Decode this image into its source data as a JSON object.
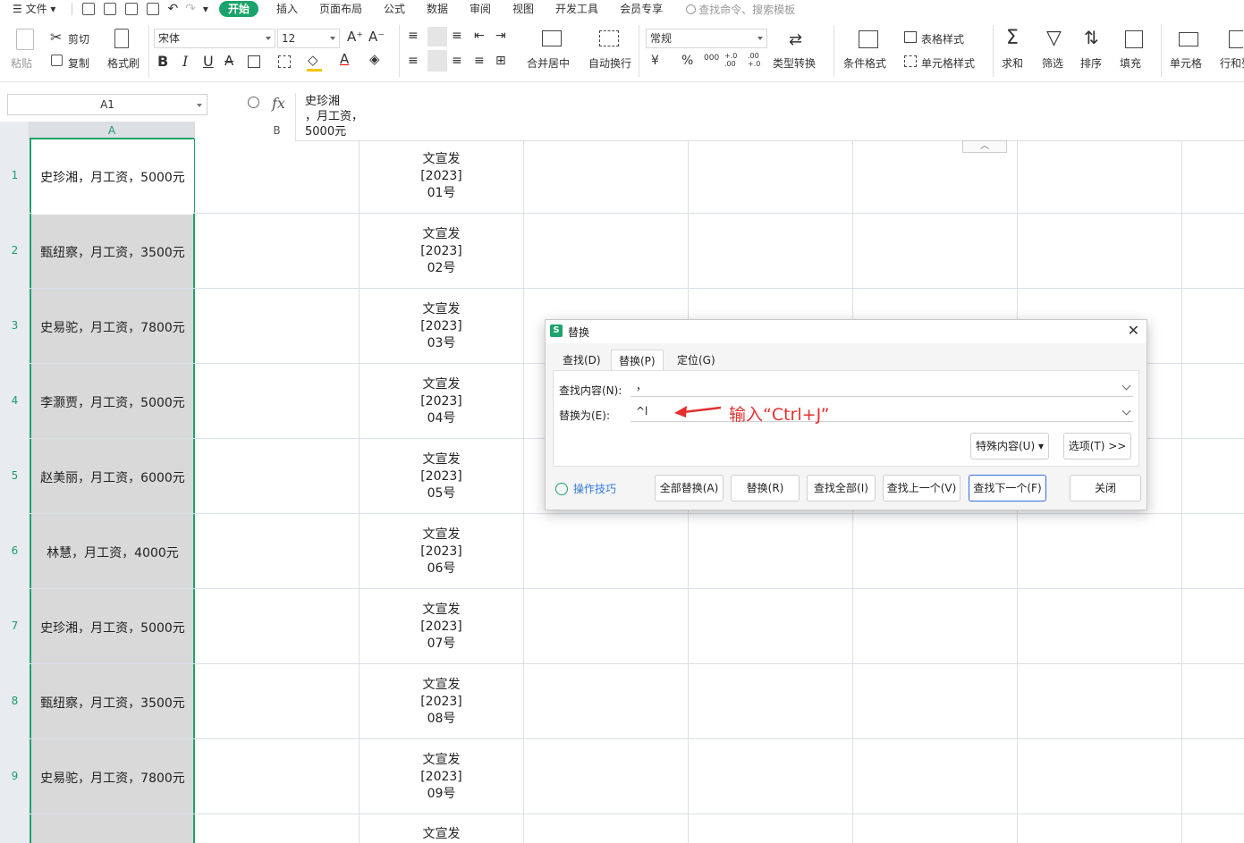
{
  "menubar": {
    "file": "文件",
    "tabs": [
      "开始",
      "插入",
      "页面布局",
      "公式",
      "数据",
      "审阅",
      "视图",
      "开发工具",
      "会员专享"
    ],
    "search_placeholder": "查找命令、搜索模板"
  },
  "ribbon": {
    "paste": "粘贴",
    "cut": "剪切",
    "copy": "复制",
    "format_painter": "格式刷",
    "font_name": "宋体",
    "font_size": "12",
    "merge_center": "合并居中",
    "wrap_text": "自动换行",
    "number_format": "常规",
    "type_convert": "类型转换",
    "conditional_format": "条件格式",
    "table_style": "表格样式",
    "cell_style": "单元格样式",
    "sum": "求和",
    "filter": "筛选",
    "sort": "排序",
    "fill": "填充",
    "cell": "单元格",
    "row_col": "行和列",
    "currency_symbol": "¥",
    "percent_symbol": "%",
    "thousands_symbol": "000",
    "inc_decimal": "+.0 .00",
    "dec_decimal": ".00 +.0"
  },
  "formula_bar": {
    "cell_ref": "A1",
    "fx": "fx",
    "content": "史珍湘\n，月工资，\n5000元"
  },
  "columns": [
    "A",
    "B"
  ],
  "rows": [
    {
      "num": "1",
      "a": "史珍湘，月工资，5000元",
      "c": [
        "文宣发",
        "[2023]",
        "01号"
      ]
    },
    {
      "num": "2",
      "a": "甄纽察，月工资，3500元",
      "c": [
        "文宣发",
        "[2023]",
        "02号"
      ]
    },
    {
      "num": "3",
      "a": "史易驼，月工资，7800元",
      "c": [
        "文宣发",
        "[2023]",
        "03号"
      ]
    },
    {
      "num": "4",
      "a": "李灏贾，月工资，5000元",
      "c": [
        "文宣发",
        "[2023]",
        "04号"
      ]
    },
    {
      "num": "5",
      "a": "赵美丽，月工资，6000元",
      "c": [
        "文宣发",
        "[2023]",
        "05号"
      ]
    },
    {
      "num": "6",
      "a": "林慧，月工资，4000元",
      "c": [
        "文宣发",
        "[2023]",
        "06号"
      ]
    },
    {
      "num": "7",
      "a": "史珍湘，月工资，5000元",
      "c": [
        "文宣发",
        "[2023]",
        "07号"
      ]
    },
    {
      "num": "8",
      "a": "甄纽察，月工资，3500元",
      "c": [
        "文宣发",
        "[2023]",
        "08号"
      ]
    },
    {
      "num": "9",
      "a": "史易驼，月工资，7800元",
      "c": [
        "文宣发",
        "[2023]",
        "09号"
      ]
    },
    {
      "num": "",
      "a": "",
      "c": [
        "文宣发",
        "",
        ""
      ]
    }
  ],
  "dialog": {
    "title": "替换",
    "tabs": [
      "查找(D)",
      "替换(P)",
      "定位(G)"
    ],
    "find_label": "查找内容(N):",
    "find_value": "，",
    "replace_label": "替换为(E):",
    "replace_value": "^l",
    "special_btn": "特殊内容(U)",
    "options_btn": "选项(T) >>",
    "tips": "操作技巧",
    "btn_replace_all": "全部替换(A)",
    "btn_replace": "替换(R)",
    "btn_find_all": "查找全部(I)",
    "btn_find_prev": "查找上一个(V)",
    "btn_find_next": "查找下一个(F)",
    "btn_close": "关闭"
  },
  "annotation": "输入“Ctrl+J”",
  "colors": {
    "accent": "#1ca36b",
    "annotation": "#e53030",
    "selection": "#d9d9d9"
  }
}
